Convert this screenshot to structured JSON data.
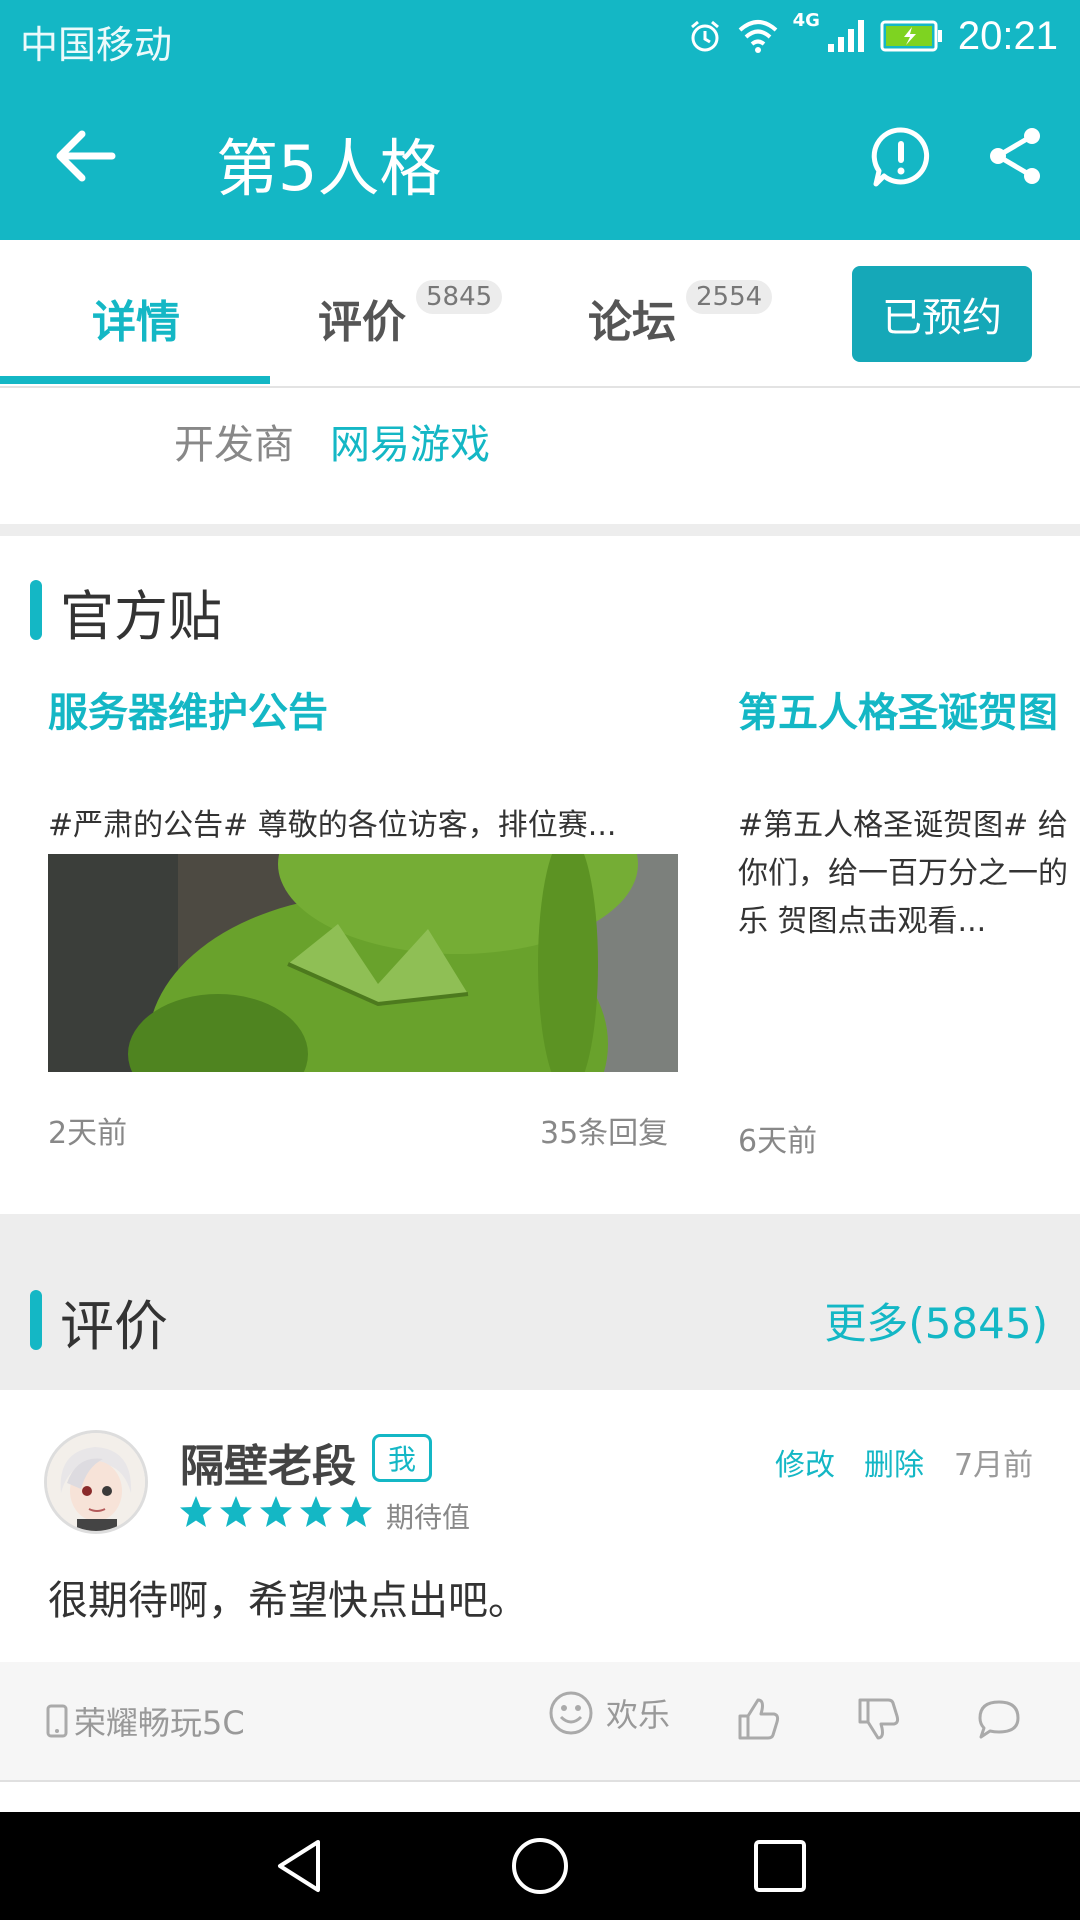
{
  "status_bar": {
    "carrier": "中国移动",
    "network": "4G",
    "time": "20:21"
  },
  "app_bar": {
    "title": "第5人格"
  },
  "tabs": [
    {
      "label": "详情",
      "count": ""
    },
    {
      "label": "评价",
      "count": "5845"
    },
    {
      "label": "论坛",
      "count": "2554"
    }
  ],
  "reserve_button": "已预约",
  "developer": {
    "label": "开发商",
    "value": "网易游戏"
  },
  "official_posts": {
    "section_title": "官方贴",
    "posts": [
      {
        "title": "服务器维护公告",
        "body": "#严肃的公告# 尊敬的各位访客，排位赛...",
        "time": "2天前",
        "replies": "35条回复"
      },
      {
        "title": "第五人格圣诞贺图",
        "body": "#第五人格圣诞贺图# 给\n你们，给一百万分之一的\n乐 贺图点击观看...",
        "time": "6天前",
        "replies": ""
      }
    ]
  },
  "reviews": {
    "section_title": "评价",
    "more_link": "更多(5845)",
    "items": [
      {
        "user": "隔壁老段",
        "badge": "我",
        "stars": 5,
        "stars_label": "期待值",
        "edit": "修改",
        "delete": "删除",
        "time": "7月前",
        "text": "很期待啊，希望快点出吧。",
        "device": "荣耀畅玩5C",
        "mood": "欢乐"
      }
    ]
  },
  "colors": {
    "accent": "#14b7c5",
    "accent_dark": "#15a8b8",
    "background_gray": "#ededed"
  }
}
